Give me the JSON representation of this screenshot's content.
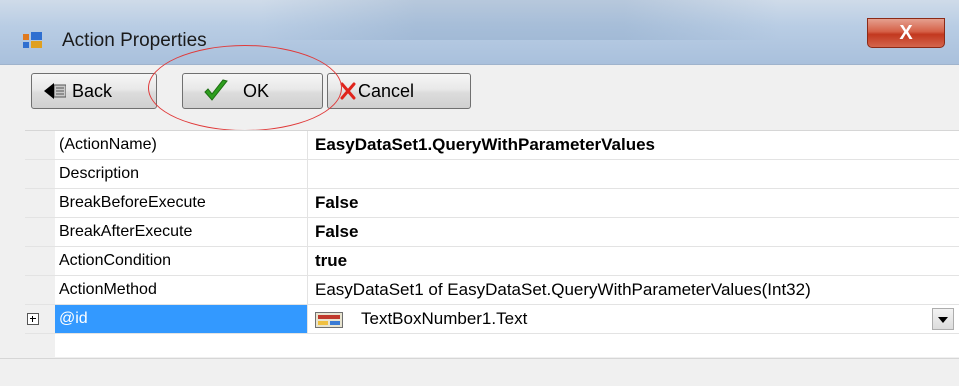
{
  "window": {
    "title": "Action Properties",
    "close_label": "X"
  },
  "toolbar": {
    "back_label": "Back",
    "ok_label": "OK",
    "cancel_label": "Cancel"
  },
  "properties": {
    "rows": [
      {
        "name": "(ActionName)",
        "value": "EasyDataSet1.QueryWithParameterValues",
        "bold": true
      },
      {
        "name": "Description",
        "value": "",
        "bold": false
      },
      {
        "name": "BreakBeforeExecute",
        "value": "False",
        "bold": true
      },
      {
        "name": "BreakAfterExecute",
        "value": "False",
        "bold": true
      },
      {
        "name": "ActionCondition",
        "value": "true",
        "bold": true
      },
      {
        "name": "ActionMethod",
        "value": "EasyDataSet1 of EasyDataSet.QueryWithParameterValues(Int32)",
        "bold": false
      },
      {
        "name": "@id",
        "value": "TextBoxNumber1.Text",
        "bold": false,
        "selected": true
      }
    ]
  },
  "colors": {
    "selection": "#3399ff",
    "close_button": "#c2381f",
    "annotation_ellipse": "#e03a3a",
    "check_icon": "#2e9e1f",
    "cancel_icon": "#e0231b"
  }
}
